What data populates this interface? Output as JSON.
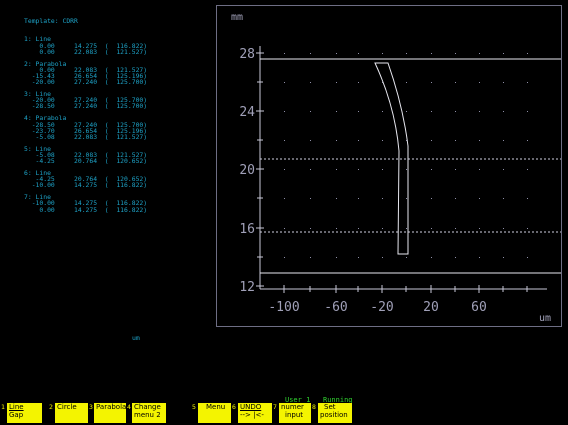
{
  "template": {
    "title": "Template: CDRR",
    "segments": [
      {
        "header": "1: Line",
        "rows": [
          "    0.00     14.275  (  116.822)",
          "    0.00     22.083  (  121.527)"
        ]
      },
      {
        "header": "2: Parabola",
        "rows": [
          "    0.00     22.083  (  121.527)",
          "  -15.43     26.654  (  125.196)",
          "  -20.00     27.240  (  125.700)"
        ]
      },
      {
        "header": "3: Line",
        "rows": [
          "  -20.00     27.240  (  125.700)",
          "  -28.50     27.240  (  125.700)"
        ]
      },
      {
        "header": "4: Parabola",
        "rows": [
          "  -28.50     27.240  (  125.700)",
          "  -23.70     26.654  (  125.196)",
          "   -5.08     22.083  (  121.527)"
        ]
      },
      {
        "header": "5: Line",
        "rows": [
          "   -5.08     22.083  (  121.527)",
          "   -4.25     20.764  (  120.652)"
        ]
      },
      {
        "header": "6: Line",
        "rows": [
          "   -4.25     20.764  (  120.652)",
          "  -10.00     14.275  (  116.822)"
        ]
      },
      {
        "header": "7: Line",
        "rows": [
          "  -10.00     14.275  (  116.822)",
          "    0.00     14.275  (  116.822)"
        ]
      }
    ]
  },
  "graph": {
    "y_unit": "mm",
    "x_unit": "um",
    "y_ticks": [
      "28",
      "24",
      "20",
      "16",
      "12"
    ],
    "x_ticks": [
      "-100",
      "-60",
      "-20",
      "20",
      "60"
    ],
    "colors": {
      "axis": "#c8c8d8",
      "profile": "#e8e8f0",
      "dotted": "#d0d0e0"
    }
  },
  "mid_unit": "um",
  "status": {
    "user": "User 1",
    "state": "Running"
  },
  "fkeys": [
    {
      "num": "1",
      "line1": " Line ",
      "line2": "Gap",
      "underline": true
    },
    {
      "num": "2",
      "line1": "Circle",
      "line2": ""
    },
    {
      "num": "3",
      "line1": "Parabola",
      "line2": ""
    },
    {
      "num": "4",
      "line1": "Change",
      "line2": "menu 2"
    },
    {
      "num": "5",
      "line1": "",
      "line2": ""
    },
    {
      "num": "",
      "line1": "Menu",
      "line2": ""
    },
    {
      "num": "6",
      "line1": "UNDO",
      "line2": "--> |<-"
    },
    {
      "num": "7",
      "line1": "numer",
      "line2": "input"
    },
    {
      "num": "8",
      "line1": "Set",
      "line2": "position"
    }
  ]
}
